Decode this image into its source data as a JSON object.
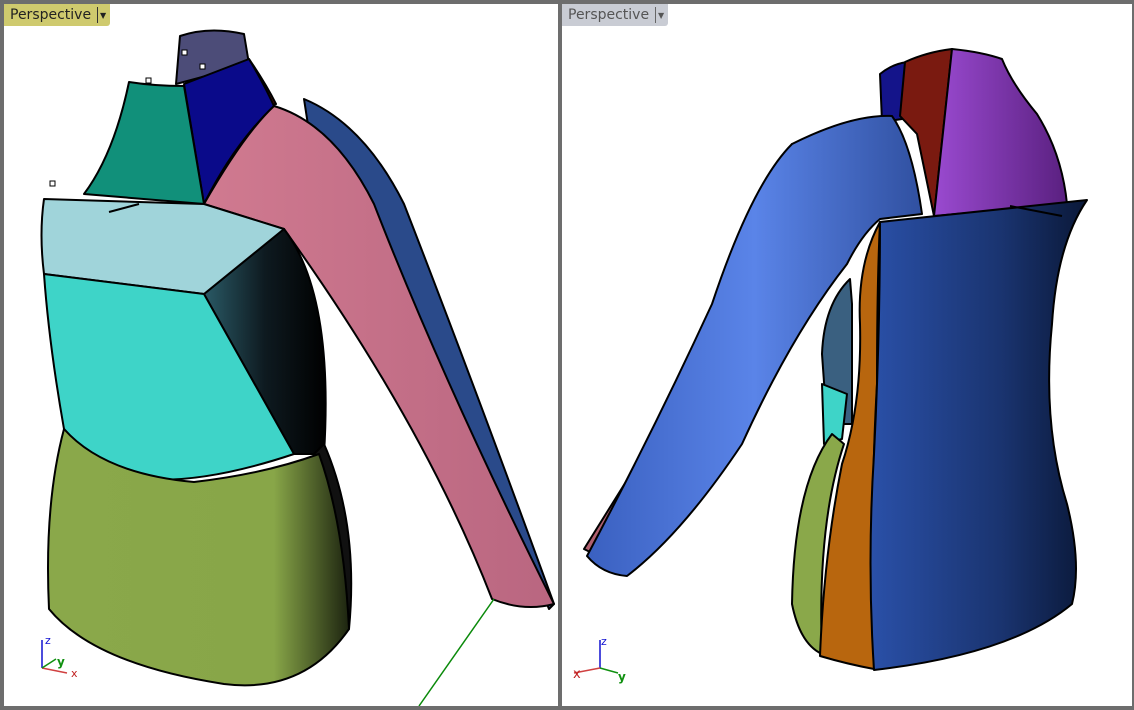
{
  "viewports": [
    {
      "title": "Perspective",
      "active": true,
      "axes": {
        "x": "x",
        "y": "y",
        "z": "z"
      }
    },
    {
      "title": "Perspective",
      "active": false,
      "axes": {
        "x": "x",
        "y": "y",
        "z": "z"
      }
    }
  ],
  "colors": {
    "active_label": "#cfca6e",
    "inactive_label": "#c9ccd4",
    "frame": "#6d6d6d",
    "sleeve_pink": "#c97088",
    "sleeve_blue": "#4f78d8",
    "skirt_green": "#8aa84a",
    "bodice_cyan": "#3ed4c8",
    "bodice_light": "#a0d4da",
    "navy": "#1a3470",
    "orange": "#b8660e",
    "purple": "#7a3aa0",
    "maroon": "#7a1a10",
    "teal": "#11907a"
  }
}
